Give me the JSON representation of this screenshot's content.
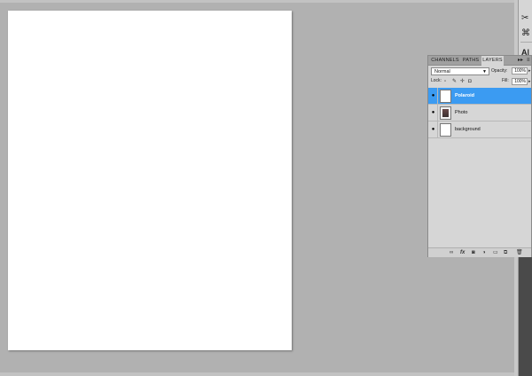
{
  "panel": {
    "tabs": [
      "CHANNELS",
      "PATHS",
      "LAYERS"
    ],
    "active_tab": "LAYERS",
    "blend_mode": "Normal",
    "opacity_label": "Opacity:",
    "opacity_value": "100%",
    "lock_label": "Lock:",
    "fill_label": "Fill:",
    "fill_value": "100%"
  },
  "layers": [
    {
      "name": "Polaroid",
      "selected": true,
      "thumb": "blank"
    },
    {
      "name": "Photo",
      "selected": false,
      "thumb": "photo"
    },
    {
      "name": "background",
      "selected": false,
      "thumb": "blank"
    }
  ],
  "tool_strip": {
    "top_label": "A|"
  },
  "colors": {
    "selection": "#3b9bf2",
    "workspace": "#b1b1b1",
    "panel": "#d6d6d6"
  }
}
